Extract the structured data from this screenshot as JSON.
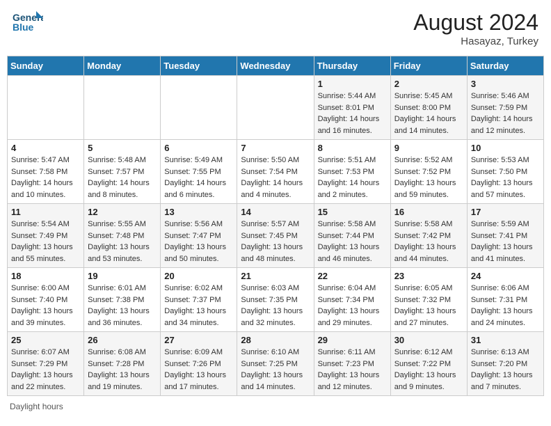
{
  "header": {
    "logo_text_general": "General",
    "logo_text_blue": "Blue",
    "month_title": "August 2024",
    "subtitle": "Hasayaz, Turkey"
  },
  "footer": {
    "daylight_label": "Daylight hours"
  },
  "days_of_week": [
    "Sunday",
    "Monday",
    "Tuesday",
    "Wednesday",
    "Thursday",
    "Friday",
    "Saturday"
  ],
  "weeks": [
    [
      {
        "num": "",
        "info": ""
      },
      {
        "num": "",
        "info": ""
      },
      {
        "num": "",
        "info": ""
      },
      {
        "num": "",
        "info": ""
      },
      {
        "num": "1",
        "info": "Sunrise: 5:44 AM\nSunset: 8:01 PM\nDaylight: 14 hours and 16 minutes."
      },
      {
        "num": "2",
        "info": "Sunrise: 5:45 AM\nSunset: 8:00 PM\nDaylight: 14 hours and 14 minutes."
      },
      {
        "num": "3",
        "info": "Sunrise: 5:46 AM\nSunset: 7:59 PM\nDaylight: 14 hours and 12 minutes."
      }
    ],
    [
      {
        "num": "4",
        "info": "Sunrise: 5:47 AM\nSunset: 7:58 PM\nDaylight: 14 hours and 10 minutes."
      },
      {
        "num": "5",
        "info": "Sunrise: 5:48 AM\nSunset: 7:57 PM\nDaylight: 14 hours and 8 minutes."
      },
      {
        "num": "6",
        "info": "Sunrise: 5:49 AM\nSunset: 7:55 PM\nDaylight: 14 hours and 6 minutes."
      },
      {
        "num": "7",
        "info": "Sunrise: 5:50 AM\nSunset: 7:54 PM\nDaylight: 14 hours and 4 minutes."
      },
      {
        "num": "8",
        "info": "Sunrise: 5:51 AM\nSunset: 7:53 PM\nDaylight: 14 hours and 2 minutes."
      },
      {
        "num": "9",
        "info": "Sunrise: 5:52 AM\nSunset: 7:52 PM\nDaylight: 13 hours and 59 minutes."
      },
      {
        "num": "10",
        "info": "Sunrise: 5:53 AM\nSunset: 7:50 PM\nDaylight: 13 hours and 57 minutes."
      }
    ],
    [
      {
        "num": "11",
        "info": "Sunrise: 5:54 AM\nSunset: 7:49 PM\nDaylight: 13 hours and 55 minutes."
      },
      {
        "num": "12",
        "info": "Sunrise: 5:55 AM\nSunset: 7:48 PM\nDaylight: 13 hours and 53 minutes."
      },
      {
        "num": "13",
        "info": "Sunrise: 5:56 AM\nSunset: 7:47 PM\nDaylight: 13 hours and 50 minutes."
      },
      {
        "num": "14",
        "info": "Sunrise: 5:57 AM\nSunset: 7:45 PM\nDaylight: 13 hours and 48 minutes."
      },
      {
        "num": "15",
        "info": "Sunrise: 5:58 AM\nSunset: 7:44 PM\nDaylight: 13 hours and 46 minutes."
      },
      {
        "num": "16",
        "info": "Sunrise: 5:58 AM\nSunset: 7:42 PM\nDaylight: 13 hours and 44 minutes."
      },
      {
        "num": "17",
        "info": "Sunrise: 5:59 AM\nSunset: 7:41 PM\nDaylight: 13 hours and 41 minutes."
      }
    ],
    [
      {
        "num": "18",
        "info": "Sunrise: 6:00 AM\nSunset: 7:40 PM\nDaylight: 13 hours and 39 minutes."
      },
      {
        "num": "19",
        "info": "Sunrise: 6:01 AM\nSunset: 7:38 PM\nDaylight: 13 hours and 36 minutes."
      },
      {
        "num": "20",
        "info": "Sunrise: 6:02 AM\nSunset: 7:37 PM\nDaylight: 13 hours and 34 minutes."
      },
      {
        "num": "21",
        "info": "Sunrise: 6:03 AM\nSunset: 7:35 PM\nDaylight: 13 hours and 32 minutes."
      },
      {
        "num": "22",
        "info": "Sunrise: 6:04 AM\nSunset: 7:34 PM\nDaylight: 13 hours and 29 minutes."
      },
      {
        "num": "23",
        "info": "Sunrise: 6:05 AM\nSunset: 7:32 PM\nDaylight: 13 hours and 27 minutes."
      },
      {
        "num": "24",
        "info": "Sunrise: 6:06 AM\nSunset: 7:31 PM\nDaylight: 13 hours and 24 minutes."
      }
    ],
    [
      {
        "num": "25",
        "info": "Sunrise: 6:07 AM\nSunset: 7:29 PM\nDaylight: 13 hours and 22 minutes."
      },
      {
        "num": "26",
        "info": "Sunrise: 6:08 AM\nSunset: 7:28 PM\nDaylight: 13 hours and 19 minutes."
      },
      {
        "num": "27",
        "info": "Sunrise: 6:09 AM\nSunset: 7:26 PM\nDaylight: 13 hours and 17 minutes."
      },
      {
        "num": "28",
        "info": "Sunrise: 6:10 AM\nSunset: 7:25 PM\nDaylight: 13 hours and 14 minutes."
      },
      {
        "num": "29",
        "info": "Sunrise: 6:11 AM\nSunset: 7:23 PM\nDaylight: 13 hours and 12 minutes."
      },
      {
        "num": "30",
        "info": "Sunrise: 6:12 AM\nSunset: 7:22 PM\nDaylight: 13 hours and 9 minutes."
      },
      {
        "num": "31",
        "info": "Sunrise: 6:13 AM\nSunset: 7:20 PM\nDaylight: 13 hours and 7 minutes."
      }
    ]
  ]
}
